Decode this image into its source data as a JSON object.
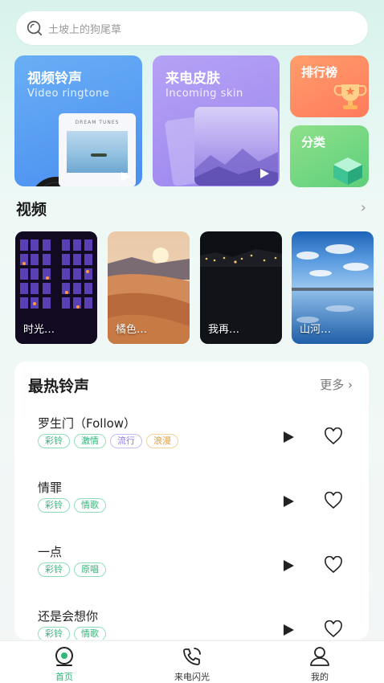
{
  "search": {
    "placeholder": "土坡上的狗尾草"
  },
  "cards": {
    "video": {
      "title": "视频铃声",
      "subtitle": "Video ringtone",
      "album_text": "DREAM TUNES"
    },
    "skin": {
      "title": "来电皮肤",
      "subtitle": "Incoming skin"
    },
    "rank": {
      "title": "排行榜"
    },
    "category": {
      "title": "分类"
    }
  },
  "video_section": {
    "title": "视频",
    "arrow": "›",
    "items": [
      {
        "label": "时光…"
      },
      {
        "label": "橘色…"
      },
      {
        "label": "我再…"
      },
      {
        "label": "山河…"
      }
    ]
  },
  "hot": {
    "title": "最热铃声",
    "more": "更多 ›",
    "songs": [
      {
        "name": "罗生门（Follow）",
        "tags": [
          "彩铃",
          "激情",
          "流行",
          "浪漫"
        ]
      },
      {
        "name": "情罪",
        "tags": [
          "彩铃",
          "情歌"
        ]
      },
      {
        "name": "一点",
        "tags": [
          "彩铃",
          "原唱"
        ]
      },
      {
        "name": "还是会想你",
        "tags": [
          "彩铃",
          "情歌"
        ]
      }
    ]
  },
  "tabbar": {
    "items": [
      {
        "label": "首页",
        "icon": "home-record-icon",
        "active": true
      },
      {
        "label": "来电闪光",
        "icon": "phone-flash-icon",
        "active": false
      },
      {
        "label": "我的",
        "icon": "user-icon",
        "active": false
      }
    ]
  },
  "colors": {
    "accent": "#2fb67a",
    "tag_teal": "#2fb67a",
    "tag_purple": "#8a7be8",
    "tag_orange": "#e0a040"
  }
}
